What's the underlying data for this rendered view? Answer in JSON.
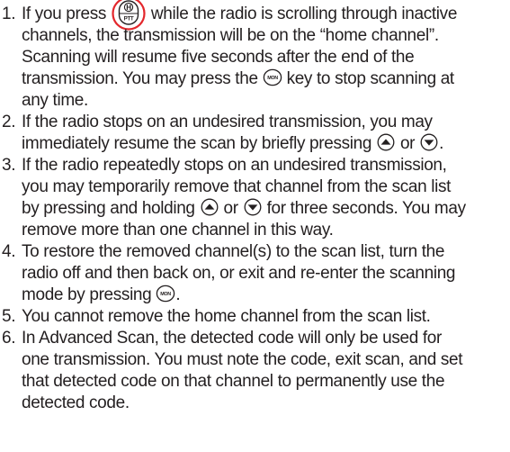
{
  "items": [
    {
      "number": "1.",
      "lines": [
        {
          "segments": [
            "If you press",
            "while the radio is scrolling through inactive"
          ]
        },
        {
          "segments": [
            "channels, the transmission will be on the “home channel”."
          ]
        },
        {
          "segments": [
            "Scanning will resume five seconds after the end of the"
          ]
        },
        {
          "segments": [
            "transmission. You may press the",
            "key to stop scanning at"
          ]
        },
        {
          "segments": [
            "any time."
          ]
        }
      ]
    },
    {
      "number": "2.",
      "lines": [
        {
          "segments": [
            "If the radio stops on an undesired transmission, you may"
          ]
        },
        {
          "segments": [
            "immediately resume the scan by briefly pressing",
            "or",
            "."
          ]
        }
      ]
    },
    {
      "number": "3.",
      "lines": [
        {
          "segments": [
            "If the radio repeatedly stops on an undesired transmission,"
          ]
        },
        {
          "segments": [
            "you may temporarily remove that channel from the scan list"
          ]
        },
        {
          "segments": [
            "by pressing and holding",
            "or",
            "for three seconds. You may"
          ]
        },
        {
          "segments": [
            "remove more than one channel in this way."
          ]
        }
      ]
    },
    {
      "number": "4.",
      "lines": [
        {
          "segments": [
            "To restore the removed channel(s) to the scan list, turn the"
          ]
        },
        {
          "segments": [
            "radio off and then back on, or exit and re-enter the scanning"
          ]
        },
        {
          "segments": [
            "mode by pressing",
            "."
          ]
        }
      ]
    },
    {
      "number": "5.",
      "lines": [
        {
          "segments": [
            "You cannot remove the home channel from the scan list."
          ]
        }
      ]
    },
    {
      "number": "6.",
      "lines": [
        {
          "segments": [
            "In Advanced Scan, the detected code will only be used for"
          ]
        },
        {
          "segments": [
            "one transmission. You must note the code, exit scan, and set"
          ]
        },
        {
          "segments": [
            "that detected code on that channel to permanently use the"
          ]
        },
        {
          "segments": [
            "detected code."
          ]
        }
      ]
    }
  ],
  "key_labels": {
    "ptt_top": "H",
    "ptt_bottom": "PTT",
    "mon": "MON"
  },
  "icon_names": {
    "ptt": "ptt-key-icon",
    "mon": "mon-key-icon",
    "up": "up-arrow-key-icon",
    "down": "down-arrow-key-icon"
  },
  "colors": {
    "text": "#231f20",
    "highlight_circle": "#e3262b"
  }
}
